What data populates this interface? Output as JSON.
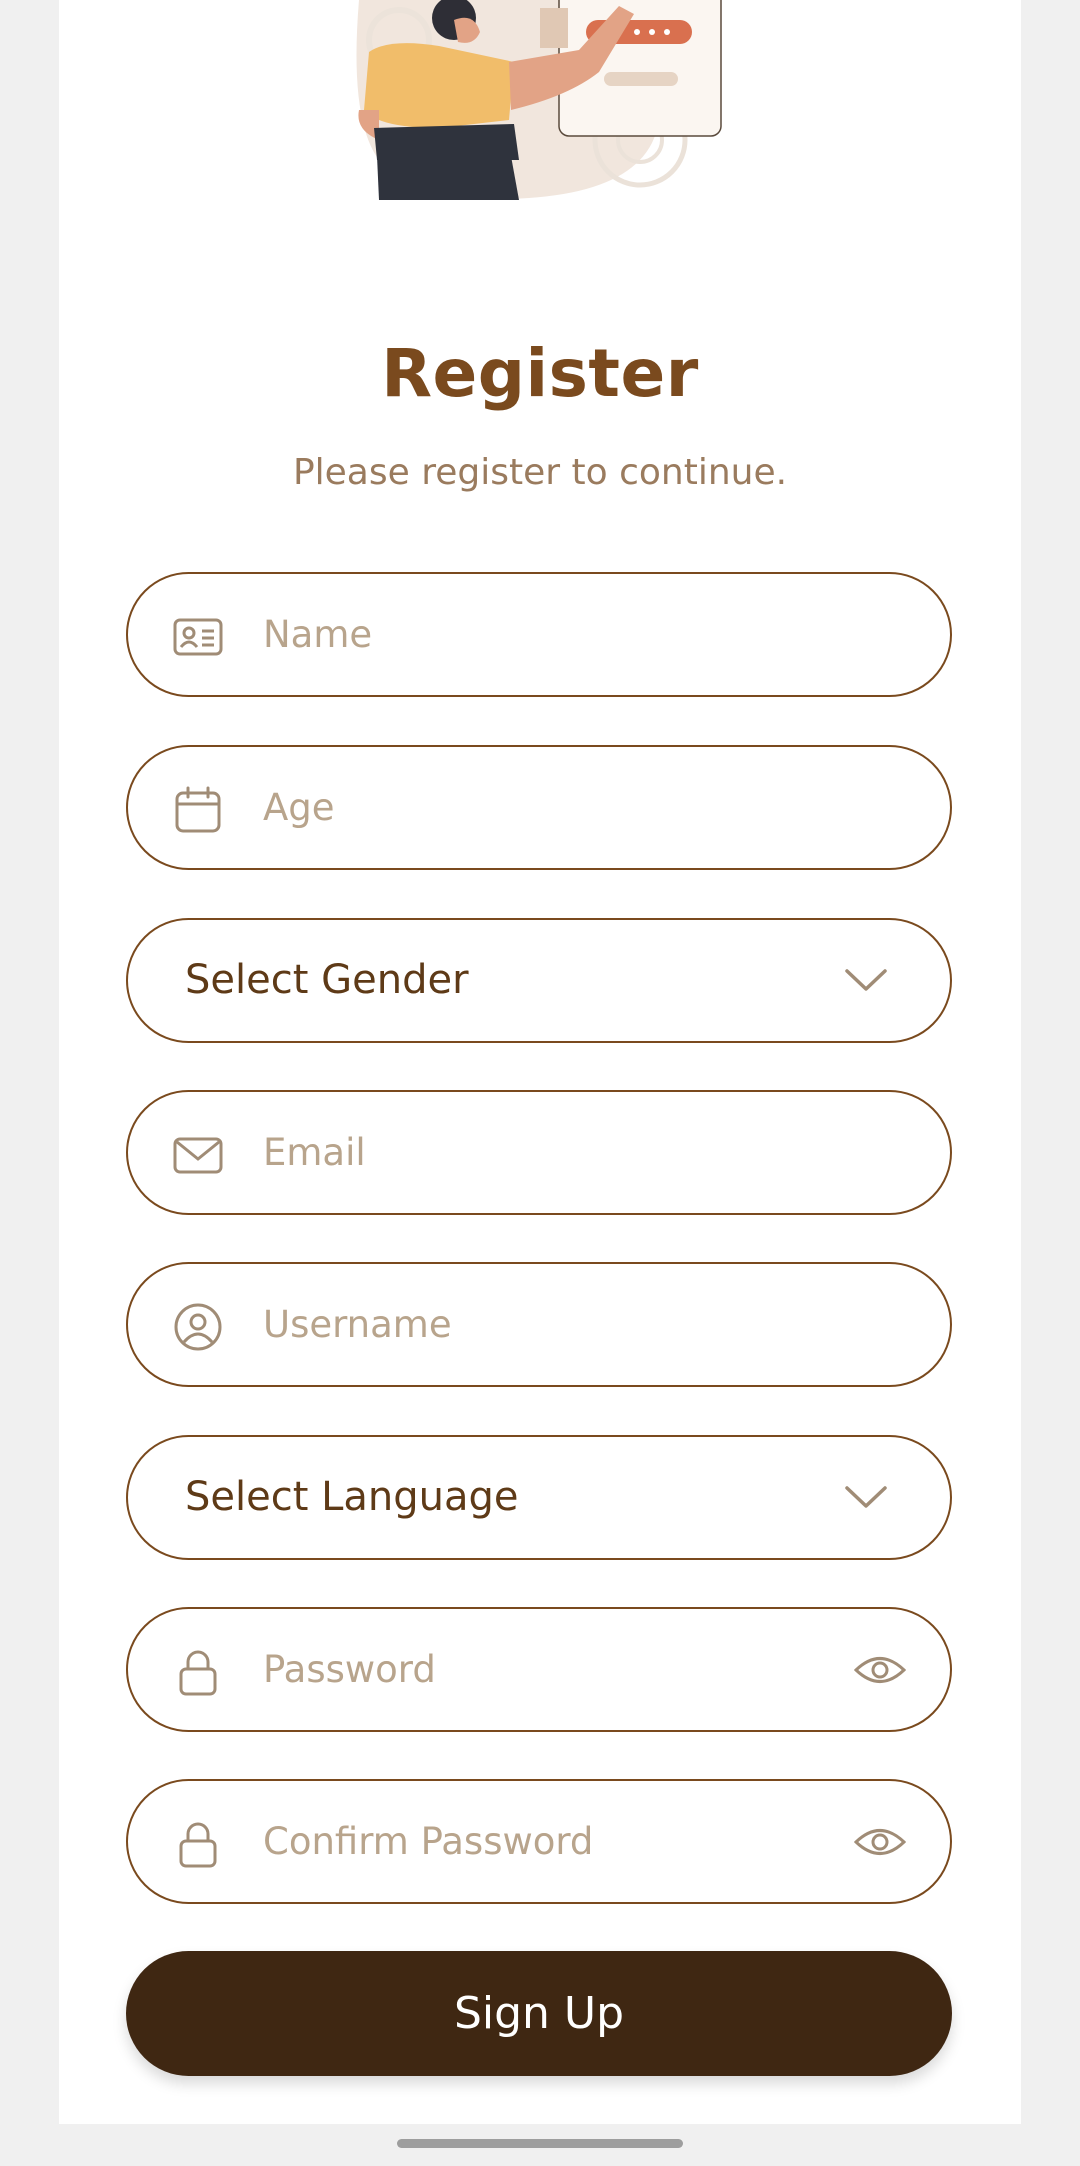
{
  "header": {
    "title": "Register",
    "subtitle": "Please register to continue."
  },
  "form": {
    "name": {
      "placeholder": "Name",
      "icon": "id-card-icon"
    },
    "age": {
      "placeholder": "Age",
      "icon": "calendar-icon"
    },
    "gender": {
      "label": "Select Gender",
      "icon": "chevron-down-icon"
    },
    "email": {
      "placeholder": "Email",
      "icon": "envelope-icon"
    },
    "username": {
      "placeholder": "Username",
      "icon": "user-circle-icon"
    },
    "language": {
      "label": "Select Language",
      "icon": "chevron-down-icon"
    },
    "password": {
      "placeholder": "Password",
      "icon": "lock-icon",
      "toggle_icon": "eye-icon"
    },
    "confirm_password": {
      "placeholder": "Confirm Password",
      "icon": "lock-icon",
      "toggle_icon": "eye-icon"
    },
    "submit_label": "Sign Up"
  },
  "colors": {
    "primary": "#3f2712",
    "heading": "#7a4a1e",
    "border": "#7a4a1e",
    "placeholder": "#b8a48c",
    "icon": "#a08c76",
    "background": "#f0f0f0"
  }
}
